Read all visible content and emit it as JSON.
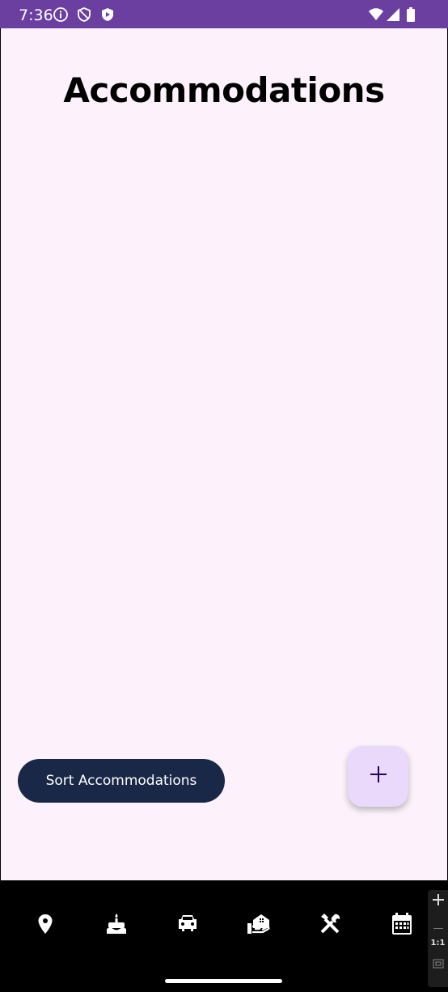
{
  "status_bar": {
    "time": "7:36",
    "left_icons": [
      "info-icon",
      "shield-icon",
      "play-protect-icon"
    ],
    "right_icons": [
      "wifi-icon",
      "signal-icon",
      "battery-icon"
    ]
  },
  "screen": {
    "title": "Accommodations",
    "sort_button_label": "Sort Accommodations",
    "fab_icon": "plus-icon"
  },
  "nav_bar": {
    "items": [
      "location-pin-icon",
      "cake-icon",
      "car-icon",
      "accommodation-icon",
      "tools-icon",
      "calendar-icon"
    ]
  },
  "side_toolbar": {
    "zoom_label": "1:1"
  },
  "colors": {
    "status_bar": "#6a3fa0",
    "background": "#fdf2fb",
    "sort_button": "#1a2847",
    "fab": "#ead9fa"
  }
}
